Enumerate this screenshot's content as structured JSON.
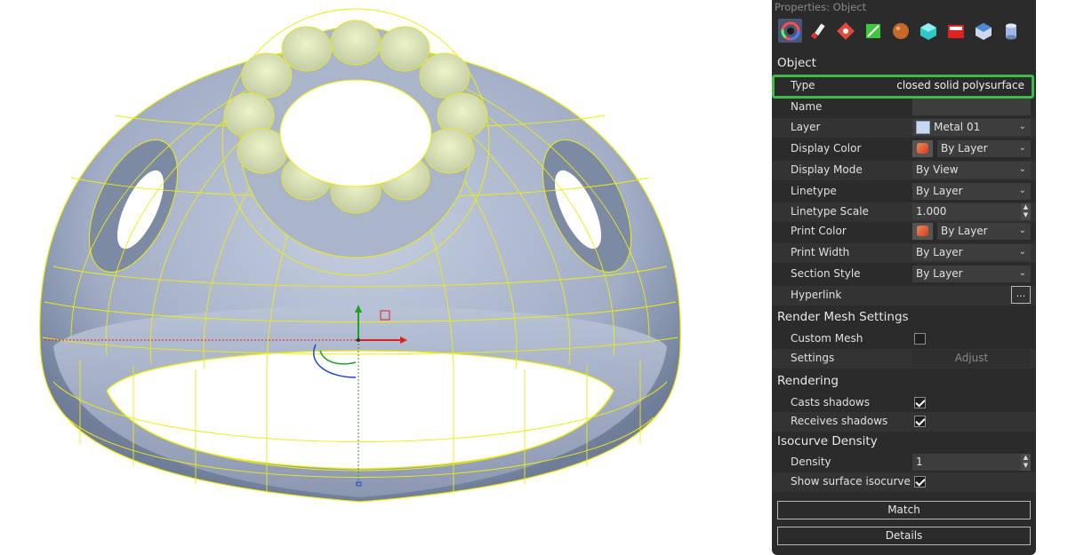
{
  "panel": {
    "title": "Properties: Object",
    "tabs": [
      "color-wheel-icon",
      "brush-icon",
      "lights-icon",
      "material-leaf-icon",
      "texture-sphere-icon",
      "rendering-cube-icon",
      "decal-box-icon",
      "bend-cube-icon",
      "cylinder-icon"
    ],
    "sections": {
      "object": "Object",
      "render_mesh": "Render Mesh Settings",
      "rendering": "Rendering",
      "isocurve": "Isocurve Density"
    },
    "properties": {
      "type_label": "Type",
      "type_value": "closed solid polysurface",
      "name_label": "Name",
      "name_value": "",
      "layer_label": "Layer",
      "layer_value": "Metal 01",
      "display_color_label": "Display Color",
      "display_color_value": "By Layer",
      "display_mode_label": "Display Mode",
      "display_mode_value": "By View",
      "linetype_label": "Linetype",
      "linetype_value": "By Layer",
      "linetype_scale_label": "Linetype Scale",
      "linetype_scale_value": "1.000",
      "print_color_label": "Print Color",
      "print_color_value": "By Layer",
      "print_width_label": "Print Width",
      "print_width_value": "By Layer",
      "section_style_label": "Section Style",
      "section_style_value": "By Layer",
      "hyperlink_label": "Hyperlink",
      "hyperlink_button": "..."
    },
    "render_mesh": {
      "custom_mesh_label": "Custom Mesh",
      "custom_mesh_checked": false,
      "settings_label": "Settings",
      "adjust_button": "Adjust"
    },
    "rendering": {
      "casts_shadows_label": "Casts shadows",
      "casts_shadows_checked": true,
      "receives_shadows_label": "Receives shadows",
      "receives_shadows_checked": true
    },
    "isocurve": {
      "density_label": "Density",
      "density_value": "1",
      "show_iso_label": "Show surface isocurve",
      "show_iso_checked": true
    },
    "buttons": {
      "match": "Match",
      "details": "Details"
    },
    "colors": {
      "highlight": "#3fb94a",
      "panel_bg": "#2b2b2b",
      "layer_swatch": "#c7d7f2"
    }
  },
  "viewport": {
    "model": "ring-with-stone-setting",
    "colors": {
      "surface": "#a9b4cb",
      "isocurves": "#f2f21a",
      "x_axis": "#e02020",
      "y_axis": "#20a020",
      "z_axis": "#2040e0"
    }
  }
}
